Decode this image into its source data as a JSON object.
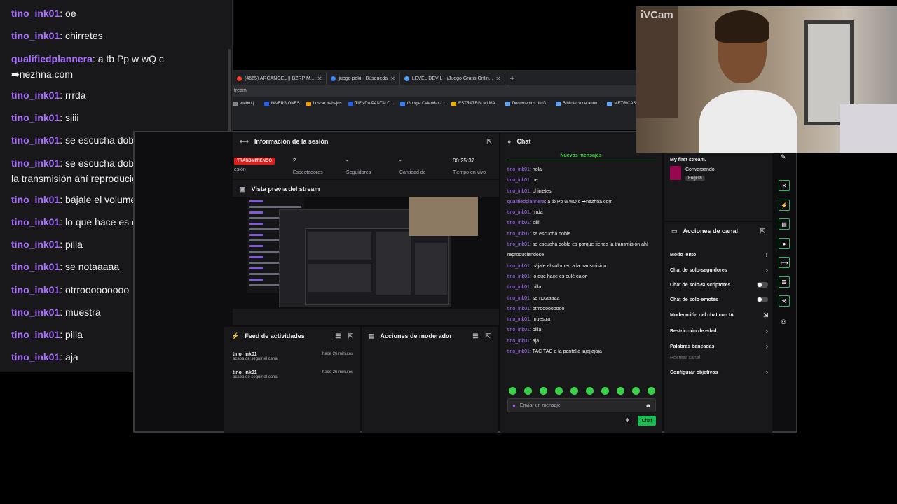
{
  "overlay_chat": [
    {
      "user": "tino_ink01",
      "text": "oe"
    },
    {
      "user": "tino_ink01",
      "text": "chirretes"
    },
    {
      "user": "qualifiedplannera",
      "text": "a tb Pp w wQ c ➡nezhna.com"
    },
    {
      "user": "tino_ink01",
      "text": "rrrda"
    },
    {
      "user": "tino_ink01",
      "text": "siiii"
    },
    {
      "user": "tino_ink01",
      "text": "se escucha doble"
    },
    {
      "user": "tino_ink01",
      "text": "se escucha doble es porque tienes la transmisión ahí reproduciendose"
    },
    {
      "user": "tino_ink01",
      "text": "bájale el volumen a la transmision"
    },
    {
      "user": "tino_ink01",
      "text": "lo que hace es culé calor"
    },
    {
      "user": "tino_ink01",
      "text": "pilla"
    },
    {
      "user": "tino_ink01",
      "text": "se notaaaaa"
    },
    {
      "user": "tino_ink01",
      "text": "otrrooooooooo"
    },
    {
      "user": "tino_ink01",
      "text": "muestra"
    },
    {
      "user": "tino_ink01",
      "text": "pilla"
    },
    {
      "user": "tino_ink01",
      "text": "aja"
    }
  ],
  "browser": {
    "tabs": [
      {
        "label": "(4665) ARCANGEL || BZRP M...",
        "color": "#ff3b30"
      },
      {
        "label": "juego poki - Búsqueda",
        "color": "#3b82f6"
      },
      {
        "label": "LEVEL DEVIL - ¡Juego Gratis Onlin...",
        "color": "#4fa3ff"
      }
    ],
    "new_tab": "+",
    "url": "tream",
    "bookmarks": [
      {
        "label": "erebro |...",
        "color": "#888888"
      },
      {
        "label": "INVERSIONES",
        "color": "#2563eb"
      },
      {
        "label": "buscar trabajos",
        "color": "#f59e0b"
      },
      {
        "label": "TIENDA PANTALO...",
        "color": "#2563eb"
      },
      {
        "label": "Google Calendar -...",
        "color": "#3b82f6"
      },
      {
        "label": "ESTRATEGI MI MA...",
        "color": "#eab308"
      },
      {
        "label": "Documentos de G...",
        "color": "#60a5fa"
      },
      {
        "label": "Biblioteca de anun...",
        "color": "#60a5fa"
      },
      {
        "label": "METRICAS",
        "color": "#60a5fa"
      }
    ]
  },
  "session": {
    "title": "Información de la sesión",
    "live_badge": "TRANSMITIENDO",
    "session_label": "esión",
    "stats": [
      {
        "value": "2",
        "label": "Espectadores"
      },
      {
        "value": "-",
        "label": "Seguidores"
      },
      {
        "value": "-",
        "label": "Cantidad de"
      },
      {
        "value": "00:25:37",
        "label": "Tiempo en vivo"
      }
    ]
  },
  "preview": {
    "title": "Vista previa del stream"
  },
  "feed": {
    "title": "Feed de actividades",
    "items": [
      {
        "name": "tino_ink01",
        "action": "acaba de seguir el canal",
        "time": "hace 26 minutos"
      },
      {
        "name": "tino_ink01",
        "action": "acaba de seguir el canal",
        "time": "hace 26 minutos"
      }
    ]
  },
  "mod": {
    "title": "Acciones de moderador"
  },
  "chat": {
    "title": "Chat",
    "new_messages": "Nuevos mensajes",
    "lines": [
      {
        "user": "tino_ink01",
        "text": ": hola"
      },
      {
        "user": "tino_ink01",
        "text": ": oe"
      },
      {
        "user": "tino_ink01",
        "text": ": chirretes"
      },
      {
        "user": "qualifiedplannera",
        "text": ": a tb Pp w wQ c ➡nezhna.com"
      },
      {
        "user": "tino_ink01",
        "text": ": rrrda"
      },
      {
        "user": "tino_ink01",
        "text": ": siiii"
      },
      {
        "user": "tino_ink01",
        "text": ": se escucha doble"
      },
      {
        "user": "tino_ink01",
        "text": ": se escucha doble es porque tienes la transmisión ahí reproduciendose"
      },
      {
        "user": "tino_ink01",
        "text": ": bájale el volumen a la transmision"
      },
      {
        "user": "tino_ink01",
        "text": ": lo que hace es culé calor"
      },
      {
        "user": "tino_ink01",
        "text": ": pilla"
      },
      {
        "user": "tino_ink01",
        "text": ": se notaaaaa"
      },
      {
        "user": "tino_ink01",
        "text": ": otrrooooooooo"
      },
      {
        "user": "tino_ink01",
        "text": ": muestra"
      },
      {
        "user": "tino_ink01",
        "text": ": pilla"
      },
      {
        "user": "tino_ink01",
        "text": ": aja"
      },
      {
        "user": "tino_ink01",
        "text": ": TAC TAC a la pantalla jajajjajaja"
      }
    ],
    "placeholder": "Enviar un mensaje",
    "send_label": "Chat"
  },
  "stream_info": {
    "title": "My first stream.",
    "category": "Conversando",
    "language": "English"
  },
  "channel_actions": {
    "title": "Acciones de canal",
    "items": [
      {
        "label": "Modo lento",
        "control": "arrow"
      },
      {
        "label": "Chat de solo-seguidores",
        "control": "arrow"
      },
      {
        "label": "Chat de solo-suscriptores",
        "control": "toggle"
      },
      {
        "label": "Chat de solo-emotes",
        "control": "toggle"
      },
      {
        "label": "Moderación del chat con IA",
        "control": "external"
      },
      {
        "label": "Restricción de edad",
        "control": "arrow"
      },
      {
        "label": "Palabras baneadas",
        "control": "arrow"
      },
      {
        "label": "Hostear canal",
        "control": "disabled"
      },
      {
        "label": "Configurar objetivos",
        "control": "arrow"
      }
    ]
  },
  "webcam": {
    "watermark": "iVCam"
  },
  "colors": {
    "username": "#a970ff",
    "live": "#e91916",
    "accent_green": "#1db954"
  }
}
